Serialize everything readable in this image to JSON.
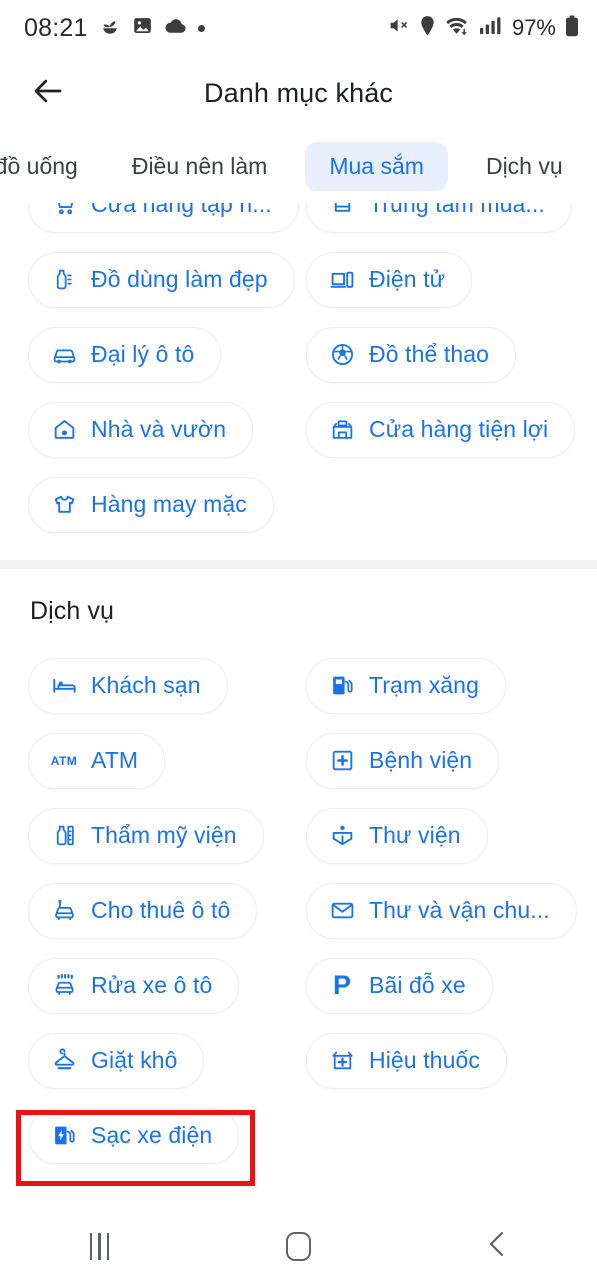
{
  "status_bar": {
    "time": "08:21",
    "left_icons": [
      "seedling-icon",
      "photo-icon",
      "cloud-icon",
      "dot-icon"
    ],
    "right_icons": [
      "mute-icon",
      "location-icon",
      "wifi-icon",
      "signal-icon"
    ],
    "battery_percent": "97%",
    "battery_icon": "battery-full-icon"
  },
  "app_bar": {
    "back_icon": "back-arrow-icon",
    "title": "Danh mục khác"
  },
  "tabs": [
    {
      "label": "và đồ uống",
      "selected": false,
      "clipped": true
    },
    {
      "label": "Điều nên làm",
      "selected": false
    },
    {
      "label": "Mua sắm",
      "selected": true
    },
    {
      "label": "Dịch vụ",
      "selected": false
    }
  ],
  "sections": [
    {
      "id": "shopping",
      "title": "",
      "chips": [
        {
          "label": "Cửa hàng tạp n...",
          "icon": "shopping-cart-icon",
          "column": "left",
          "row": 0
        },
        {
          "label": "Trung tâm mua...",
          "icon": "shopping-mall-icon",
          "column": "right",
          "row": 0
        },
        {
          "label": "Đồ dùng làm đẹp",
          "icon": "beauty-supply-icon",
          "column": "left",
          "row": 1
        },
        {
          "label": "Điện tử",
          "icon": "electronics-icon",
          "column": "right",
          "row": 1
        },
        {
          "label": "Đại lý ô tô",
          "icon": "car-dealer-icon",
          "column": "left",
          "row": 2
        },
        {
          "label": "Đồ thể thao",
          "icon": "sports-ball-icon",
          "column": "right",
          "row": 2
        },
        {
          "label": "Nhà và vườn",
          "icon": "home-garden-icon",
          "column": "left",
          "row": 3
        },
        {
          "label": "Cửa hàng tiện lợi",
          "icon": "convenience-store-icon",
          "column": "right",
          "row": 3
        },
        {
          "label": "Hàng may mặc",
          "icon": "apparel-shirt-icon",
          "column": "left",
          "row": 4
        }
      ]
    },
    {
      "id": "services",
      "title": "Dịch vụ",
      "chips": [
        {
          "label": "Khách sạn",
          "icon": "hotel-bed-icon",
          "column": "left",
          "row": 0
        },
        {
          "label": "Trạm xăng",
          "icon": "gas-station-icon",
          "column": "right",
          "row": 0
        },
        {
          "label": "ATM",
          "icon": "atm-icon",
          "column": "left",
          "row": 1
        },
        {
          "label": "Bệnh viện",
          "icon": "hospital-icon",
          "column": "right",
          "row": 1
        },
        {
          "label": "Thẩm mỹ viện",
          "icon": "beauty-salon-icon",
          "column": "left",
          "row": 2
        },
        {
          "label": "Thư viện",
          "icon": "library-icon",
          "column": "right",
          "row": 2
        },
        {
          "label": "Cho thuê ô tô",
          "icon": "car-rental-icon",
          "column": "left",
          "row": 3
        },
        {
          "label": "Thư và vận chu...",
          "icon": "mail-icon",
          "column": "right",
          "row": 3
        },
        {
          "label": "Rửa xe ô tô",
          "icon": "car-wash-icon",
          "column": "left",
          "row": 4
        },
        {
          "label": "Bãi đỗ xe",
          "icon": "parking-icon",
          "column": "right",
          "row": 4
        },
        {
          "label": "Giặt khô",
          "icon": "dry-cleaning-icon",
          "column": "left",
          "row": 5
        },
        {
          "label": "Hiệu thuốc",
          "icon": "pharmacy-icon",
          "column": "right",
          "row": 5
        },
        {
          "label": "Sạc xe điện",
          "icon": "ev-charging-icon",
          "column": "left",
          "row": 6,
          "highlighted": true
        }
      ]
    }
  ],
  "highlight": {
    "target_label": "Sạc xe điện",
    "color": "#ee1111"
  },
  "nav_bar": {
    "recents_icon": "recents-icon",
    "home_icon": "home-icon",
    "back_icon": "nav-back-icon"
  },
  "colors": {
    "accent_blue": "#1a73e8",
    "selected_tab_bg": "#e8f0fe",
    "chip_border": "#eceef0",
    "divider": "#f1f1f3",
    "text_primary": "#202124",
    "highlight_red": "#ee1111"
  }
}
